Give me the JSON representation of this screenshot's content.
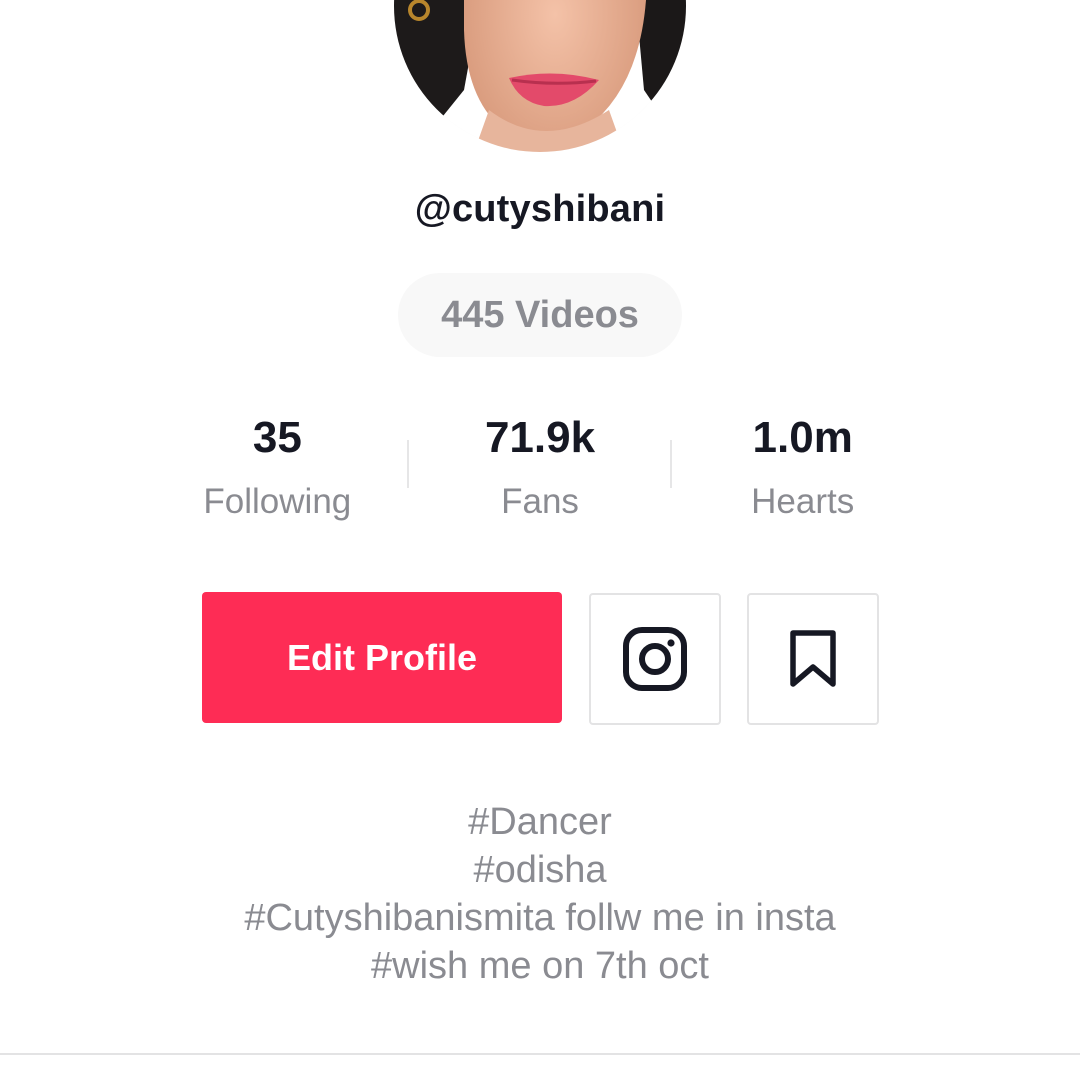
{
  "profile": {
    "username": "@cutyshibani",
    "videos_label": "445 Videos"
  },
  "stats": [
    {
      "value": "35",
      "label": "Following"
    },
    {
      "value": "71.9k",
      "label": "Fans"
    },
    {
      "value": "1.0m",
      "label": "Hearts"
    }
  ],
  "actions": {
    "edit_profile_label": "Edit Profile",
    "instagram_icon": "instagram-icon",
    "bookmark_icon": "bookmark-icon"
  },
  "bio": [
    "#Dancer",
    "#odisha",
    "#Cutyshibanismita follw me in insta",
    "#wish me on 7th oct"
  ],
  "colors": {
    "accent": "#fe2c55",
    "text_primary": "#161823",
    "text_secondary": "#8a8b91"
  }
}
